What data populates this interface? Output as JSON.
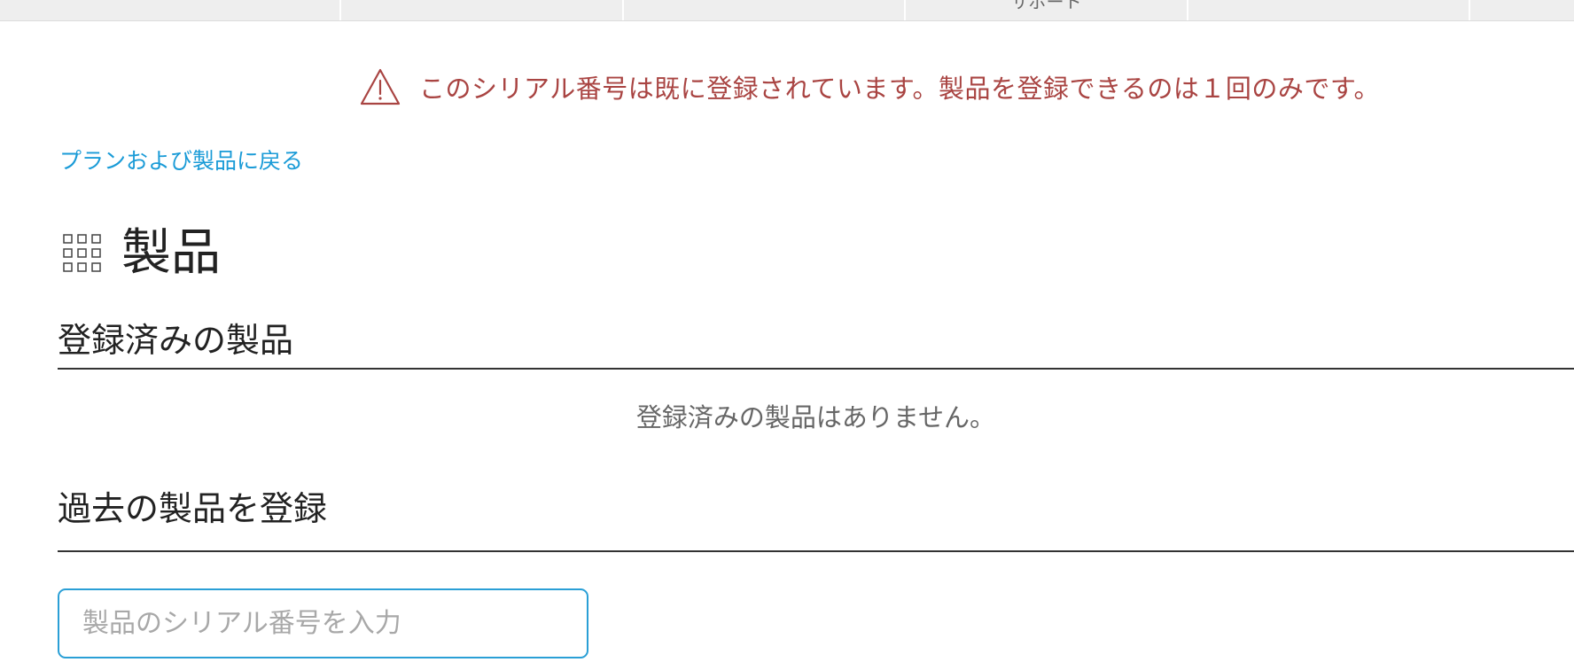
{
  "tabs": [
    {
      "label": ""
    },
    {
      "label": ""
    },
    {
      "label": ""
    },
    {
      "label": "サポート"
    },
    {
      "label": ""
    },
    {
      "label": ""
    }
  ],
  "alert": {
    "icon": "warning-triangle-icon",
    "message": "このシリアル番号は既に登録されています。製品を登録できるのは１回のみです。",
    "color": "#a94442"
  },
  "back_link": {
    "label": "プランおよび製品に戻る",
    "color": "#1a9bd7"
  },
  "page": {
    "title": "製品",
    "title_icon": "grid-icon"
  },
  "registered_section": {
    "heading": "登録済みの製品",
    "empty_message": "登録済みの製品はありません。"
  },
  "register_section": {
    "heading": "過去の製品を登録",
    "serial_input": {
      "value": "",
      "placeholder": "製品のシリアル番号を入力"
    }
  }
}
